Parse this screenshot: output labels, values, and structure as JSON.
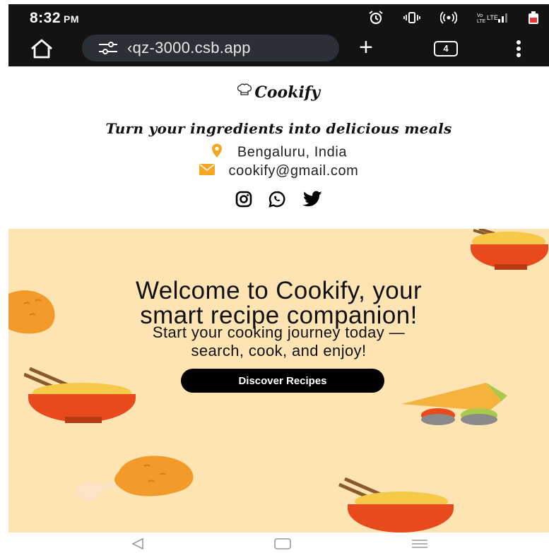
{
  "status_bar": {
    "time": "8:32",
    "meridiem": "PM"
  },
  "browser": {
    "url": "‹qz-3000.csb.app",
    "plus": "+",
    "tab_count": "4"
  },
  "site": {
    "logo_text": "Cookify",
    "tagline": "Turn your ingredients into delicious meals",
    "location": "Bengaluru, India",
    "email": "cookify@gmail.com"
  },
  "hero": {
    "title_line1": "Welcome to Cookify, your",
    "title_line2": "smart recipe companion!",
    "subtitle_line1": "Start your cooking journey today —",
    "subtitle_line2": "search, cook, and enjoy!",
    "cta_label": "Discover Recipes"
  },
  "colors": {
    "hero_bg": "#fde4b2",
    "accent": "#f5a623",
    "button_bg": "#000000"
  }
}
